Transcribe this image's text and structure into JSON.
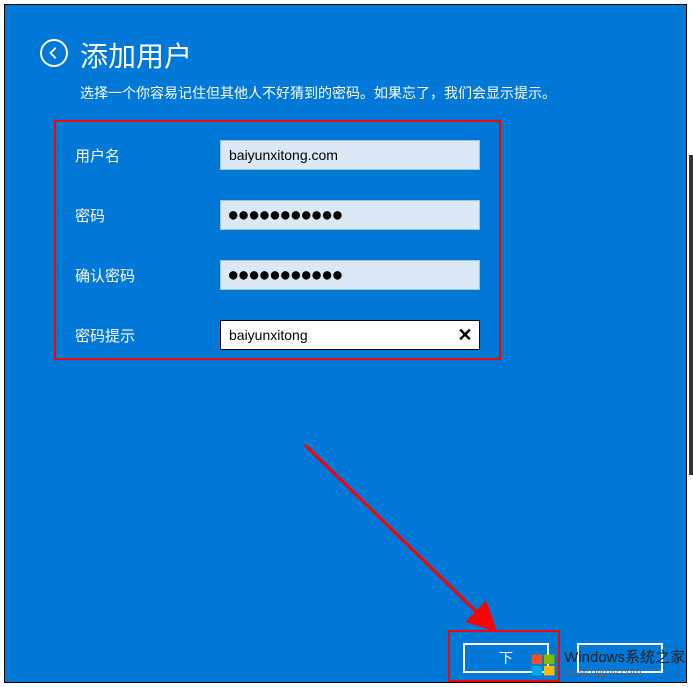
{
  "header": {
    "title": "添加用户",
    "subtitle": "选择一个你容易记住但其他人不好猜到的密码。如果忘了，我们会显示提示。"
  },
  "form": {
    "username": {
      "label": "用户名",
      "value": "baiyunxitong.com"
    },
    "password": {
      "label": "密码",
      "value": "●●●●●●●●●●●"
    },
    "confirm": {
      "label": "确认密码",
      "value": "●●●●●●●●●●●"
    },
    "hint": {
      "label": "密码提示",
      "value": "baiyunxitong"
    }
  },
  "buttons": {
    "next": "下",
    "cancel": ""
  },
  "watermark": {
    "line1": "Windows系统之家",
    "line2": "www.bjjmlv.com"
  }
}
